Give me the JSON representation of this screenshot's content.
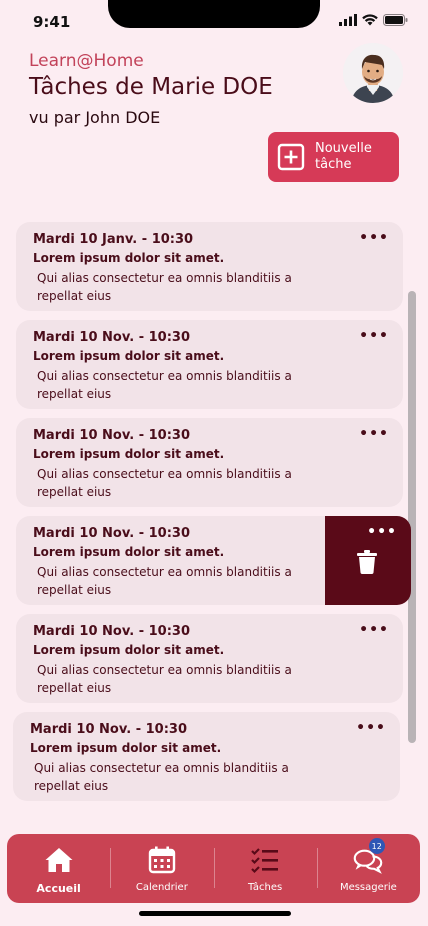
{
  "status_bar": {
    "time": "9:41"
  },
  "header": {
    "brand": "Learn@Home",
    "title": "Tâches de Marie DOE",
    "viewer": "vu par John DOE"
  },
  "actions": {
    "new_task_label": "Nouvelle tâche"
  },
  "tasks": [
    {
      "date": "Mardi  10 Janv. - 10:30",
      "subject": "Lorem ipsum dolor sit amet.",
      "description": "Qui alias consectetur ea omnis blanditiis a repellat eius",
      "menu": "•••"
    },
    {
      "date": "Mardi  10 Nov. - 10:30",
      "subject": "Lorem ipsum dolor sit amet.",
      "description": "Qui alias consectetur ea omnis blanditiis a repellat eius",
      "menu": "•••"
    },
    {
      "date": "Mardi  10 Nov. - 10:30",
      "subject": "Lorem ipsum dolor sit amet.",
      "description": "Qui alias consectetur ea omnis blanditiis a repellat eius",
      "menu": "•••"
    },
    {
      "date": "Mardi  10 Nov. - 10:30",
      "subject": "Lorem ipsum dolor sit amet.",
      "description": "Qui alias consectetur ea omnis blanditiis a repellat eius",
      "menu": "•••"
    },
    {
      "date": "Mardi  10 Nov. - 10:30",
      "subject": "Lorem ipsum dolor sit amet.",
      "description": "Qui alias consectetur ea omnis blanditiis a repellat eius",
      "menu": "•••"
    },
    {
      "date": "Mardi  10 Nov. - 10:30",
      "subject": "Lorem ipsum dolor sit amet.",
      "description": "Qui alias consectetur ea omnis blanditiis a repellat eius",
      "menu": "•••"
    }
  ],
  "tab_bar": {
    "tabs": [
      {
        "label": "Accueil",
        "icon": "home-icon",
        "active": true
      },
      {
        "label": "Calendrier",
        "icon": "calendar-icon",
        "active": false
      },
      {
        "label": "Tâches",
        "icon": "tasks-icon",
        "active": false
      },
      {
        "label": "Messagerie",
        "icon": "chat-icon",
        "active": false,
        "badge": "12"
      }
    ]
  },
  "colors": {
    "background": "#fcedf2",
    "accent": "#d63a57",
    "card": "#f2e3e8",
    "delete": "#5a0a18",
    "tab_bar": "#c94353",
    "badge": "#2f57b5"
  }
}
